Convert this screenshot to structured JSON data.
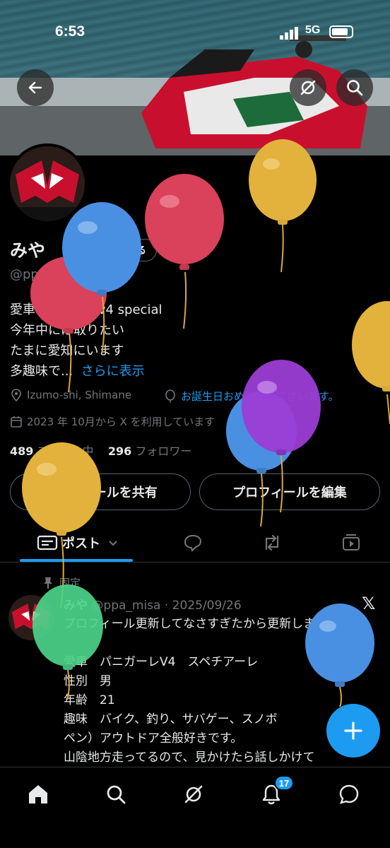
{
  "status_bar": {
    "time": "6:53",
    "network": "5G"
  },
  "profile": {
    "name": "みや",
    "verify_label": "認証を受ける",
    "handle": "@ppa_misa",
    "bio_lines": [
      "愛車 panigale v4 special",
      "今年中には取りたい",
      "たまに愛知にいます",
      "多趣味で..."
    ],
    "show_more": "さらに表示",
    "location": "Izumo-shi, Shimane",
    "birthday": "お誕生日おめでとうございます。",
    "joined": "2023 年 10月から X を利用しています",
    "following_count": "489",
    "following_label": "フォロー中",
    "followers_count": "296",
    "followers_label": "フォロワー"
  },
  "actions": {
    "share": "プロフィールを共有",
    "edit": "プロフィールを編集"
  },
  "tabs": {
    "posts": "ポスト"
  },
  "post": {
    "pinned_label": "固定",
    "author": "みや",
    "handle_date": "@ppa_misa · 2025/09/26",
    "text": "プロフィール更新してなさすぎたから更新します\n\n愛車　パニガーレV4　スペチアーレ\n性別　男\n年齢　21\n趣味　バイク、釣り、サバゲー、スノボ\nペン）アウトドア全般好きです。\n山陰地方走ってるので、見かけたら話しかけて"
  },
  "notifications_badge": "17",
  "colors": {
    "accent": "#1d9bf0",
    "background": "#000000",
    "muted": "#71767b"
  }
}
